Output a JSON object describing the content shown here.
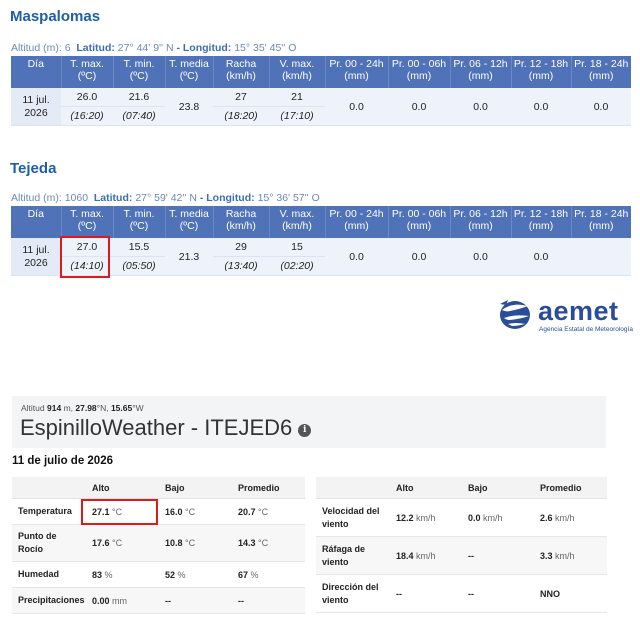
{
  "aemet_columns": [
    "Día",
    "T. max.\n(ºC)",
    "T. min.\n(ºC)",
    "T. media\n(ºC)",
    "Racha\n(km/h)",
    "V. max.\n(km/h)",
    "Pr. 00 - 24h\n(mm)",
    "Pr. 00 - 06h\n(mm)",
    "Pr. 06 - 12h\n(mm)",
    "Pr. 12 - 18h\n(mm)",
    "Pr. 18 - 24h\n(mm)"
  ],
  "stations": [
    {
      "name": "Maspalomas",
      "altitude_label": "Altitud (m):",
      "altitude": "6",
      "latitude_label": "Latitud:",
      "latitude": "27° 44' 9'' N",
      "longitude_label": "- Longitud:",
      "longitude": "15° 35' 45'' O",
      "date": "11 jul.\n2026",
      "tmax": "26.0",
      "tmax_time": "(16:20)",
      "tmin": "21.6",
      "tmin_time": "(07:40)",
      "tmean": "23.8",
      "gust": "27",
      "gust_time": "(18:20)",
      "vmax": "21",
      "vmax_time": "(17:10)",
      "pr_00_24": "0.0",
      "pr_00_06": "0.0",
      "pr_06_12": "0.0",
      "pr_12_18": "0.0",
      "pr_18_24": "0.0"
    },
    {
      "name": "Tejeda",
      "altitude_label": "Altitud (m):",
      "altitude": "1060",
      "latitude_label": "Latitud:",
      "latitude": "27° 59' 42'' N",
      "longitude_label": "- Longitud:",
      "longitude": "15° 36' 57'' O",
      "date": "11 jul.\n2026",
      "tmax": "27.0",
      "tmax_time": "(14:10)",
      "tmin": "15.5",
      "tmin_time": "(05:50)",
      "tmean": "21.3",
      "gust": "29",
      "gust_time": "(13:40)",
      "vmax": "15",
      "vmax_time": "(02:20)",
      "pr_00_24": "0.0",
      "pr_00_06": "0.0",
      "pr_06_12": "0.0",
      "pr_12_18": "0.0",
      "pr_18_24": ""
    }
  ],
  "aemet_logo": {
    "word": "aemet",
    "subtitle": "Agencia Estatal de Meteorología",
    "color": "#2a4d9b"
  },
  "wu": {
    "altitude_label": "Altitud",
    "altitude": "914",
    "altitude_unit": "m,",
    "lat": "27.98",
    "lat_unit": "°N,",
    "lon": "15.65",
    "lon_unit": "°W",
    "title": "EspinilloWeather - ITEJED6",
    "info_glyph": "i",
    "date": "11 de julio de 2026",
    "headers": [
      "",
      "Alto",
      "Bajo",
      "Promedio"
    ],
    "left_rows": [
      {
        "label": "Temperatura",
        "high": "27.1",
        "high_unit": "°C",
        "low": "16.0",
        "low_unit": "°C",
        "avg": "20.7",
        "avg_unit": "°C"
      },
      {
        "label": "Punto de\nRocío",
        "high": "17.6",
        "high_unit": "°C",
        "low": "10.8",
        "low_unit": "°C",
        "avg": "14.3",
        "avg_unit": "°C"
      },
      {
        "label": "Humedad",
        "high": "83",
        "high_unit": "%",
        "low": "52",
        "low_unit": "%",
        "avg": "67",
        "avg_unit": "%"
      },
      {
        "label": "Precipitaciones",
        "high": "0.00",
        "high_unit": "mm",
        "low": "--",
        "low_unit": "",
        "avg": "--",
        "avg_unit": ""
      }
    ],
    "right_rows": [
      {
        "label": "Velocidad del\nviento",
        "high": "12.2",
        "high_unit": "km/h",
        "low": "0.0",
        "low_unit": "km/h",
        "avg": "2.6",
        "avg_unit": "km/h"
      },
      {
        "label": "Ráfaga de\nviento",
        "high": "18.4",
        "high_unit": "km/h",
        "low": "--",
        "low_unit": "",
        "avg": "3.3",
        "avg_unit": "km/h"
      },
      {
        "label": "Dirección del\nviento",
        "high": "--",
        "high_unit": "",
        "low": "--",
        "low_unit": "",
        "avg": "NNO",
        "avg_unit": ""
      }
    ]
  },
  "highlight_color": "#e0191b"
}
